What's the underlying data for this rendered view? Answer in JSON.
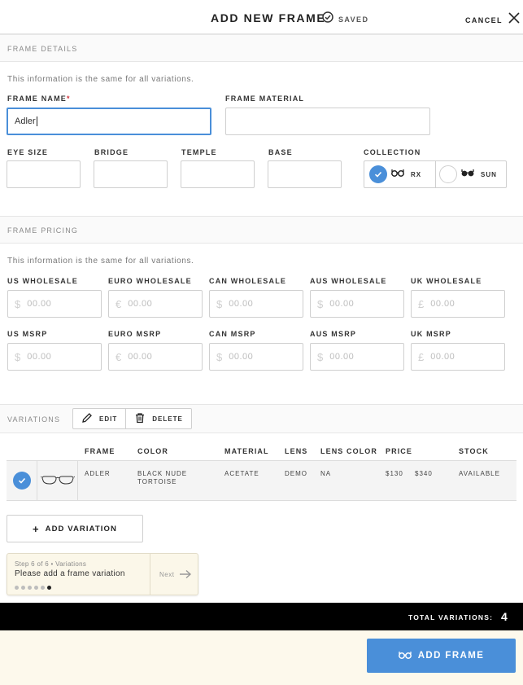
{
  "header": {
    "title": "ADD NEW FRAME",
    "saved_label": "SAVED",
    "cancel_label": "CANCEL"
  },
  "details": {
    "section_label": "FRAME DETAILS",
    "note": "This information is the same for all variations.",
    "frame_name_label": "FRAME NAME",
    "frame_name_required": "*",
    "frame_name_value": "Adler",
    "frame_material_label": "FRAME MATERIAL",
    "frame_material_value": "",
    "eye_size_label": "EYE SIZE",
    "bridge_label": "BRIDGE",
    "temple_label": "TEMPLE",
    "base_label": "BASE",
    "collection_label": "COLLECTION",
    "collection_options": [
      {
        "label": "RX",
        "selected": true,
        "icon": "eyeglasses-icon"
      },
      {
        "label": "SUN",
        "selected": false,
        "icon": "sunglasses-icon"
      }
    ]
  },
  "pricing": {
    "section_label": "FRAME PRICING",
    "note": "This information is the same for all variations.",
    "wholesale": [
      {
        "label": "US WHOLESALE",
        "currency": "$",
        "placeholder": "00.00"
      },
      {
        "label": "EURO WHOLESALE",
        "currency": "€",
        "placeholder": "00.00"
      },
      {
        "label": "CAN WHOLESALE",
        "currency": "$",
        "placeholder": "00.00"
      },
      {
        "label": "AUS WHOLESALE",
        "currency": "$",
        "placeholder": "00.00"
      },
      {
        "label": "UK WHOLESALE",
        "currency": "£",
        "placeholder": "00.00"
      }
    ],
    "msrp": [
      {
        "label": "US MSRP",
        "currency": "$",
        "placeholder": "00.00"
      },
      {
        "label": "EURO MSRP",
        "currency": "€",
        "placeholder": "00.00"
      },
      {
        "label": "CAN MSRP",
        "currency": "$",
        "placeholder": "00.00"
      },
      {
        "label": "AUS MSRP",
        "currency": "$",
        "placeholder": "00.00"
      },
      {
        "label": "UK MSRP",
        "currency": "£",
        "placeholder": "00.00"
      }
    ]
  },
  "variations": {
    "section_label": "VARIATIONS",
    "edit_label": "EDIT",
    "delete_label": "DELETE",
    "columns": [
      "FRAME",
      "COLOR",
      "MATERIAL",
      "LENS",
      "LENS COLOR",
      "PRICE",
      "STOCK"
    ],
    "rows": [
      {
        "frame": "ADLER",
        "color_line1": "BLACK NUDE",
        "color_line2": "TORTOISE",
        "material": "ACETATE",
        "lens": "DEMO",
        "lens_color": "NA",
        "price_1": "$130",
        "price_2": "$340",
        "stock": "AVAILABLE",
        "selected": true
      }
    ],
    "add_label": "ADD VARIATION"
  },
  "tooltip": {
    "step": "Step 6 of 6 • Variations",
    "message": "Please add a frame variation",
    "next_label": "Next",
    "total_steps": 6,
    "current_step": 6
  },
  "footer": {
    "total_label": "TOTAL VARIATIONS:",
    "total_count": "4",
    "add_frame_label": "ADD FRAME"
  },
  "colors": {
    "accent": "#4a8fd9",
    "required": "#d0323a",
    "footer_bar": "#000000",
    "footer_bg": "#fdf9ec"
  }
}
